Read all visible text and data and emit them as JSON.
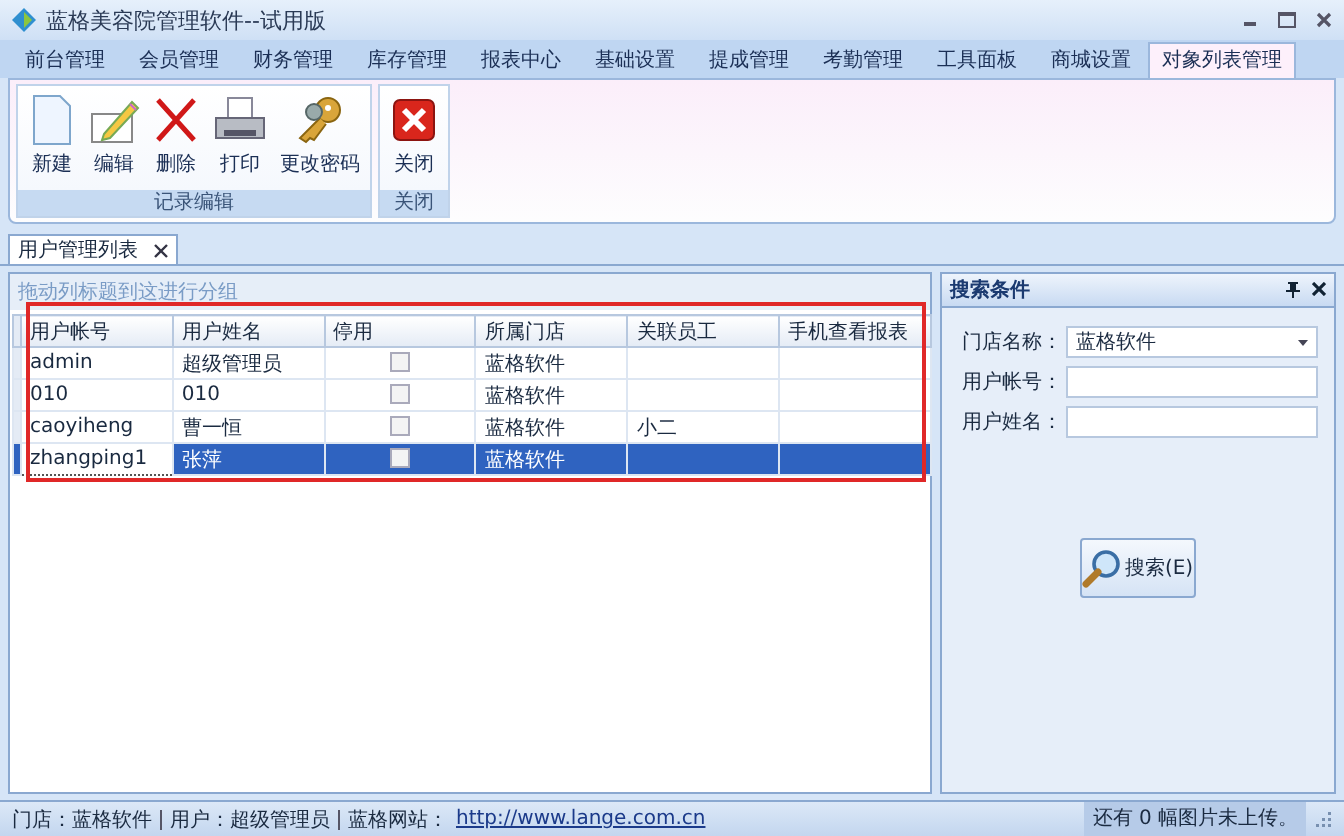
{
  "window": {
    "title": "蓝格美容院管理软件--试用版"
  },
  "menu_tabs": [
    {
      "label": "前台管理",
      "selected": false
    },
    {
      "label": "会员管理",
      "selected": false
    },
    {
      "label": "财务管理",
      "selected": false
    },
    {
      "label": "库存管理",
      "selected": false
    },
    {
      "label": "报表中心",
      "selected": false
    },
    {
      "label": "基础设置",
      "selected": false
    },
    {
      "label": "提成管理",
      "selected": false
    },
    {
      "label": "考勤管理",
      "selected": false
    },
    {
      "label": "工具面板",
      "selected": false
    },
    {
      "label": "商城设置",
      "selected": false
    },
    {
      "label": "对象列表管理",
      "selected": true
    }
  ],
  "ribbon": {
    "groups": [
      {
        "label": "记录编辑",
        "buttons": [
          {
            "label": "新建",
            "kind": "new"
          },
          {
            "label": "编辑",
            "kind": "edit"
          },
          {
            "label": "删除",
            "kind": "delete"
          },
          {
            "label": "打印",
            "kind": "print"
          },
          {
            "label": "更改密码",
            "kind": "password"
          }
        ]
      },
      {
        "label": "关闭",
        "buttons": [
          {
            "label": "关闭",
            "kind": "close"
          }
        ]
      }
    ]
  },
  "document_tabs": [
    {
      "label": "用户管理列表",
      "selected": true
    }
  ],
  "grid": {
    "group_hint": "拖动列标题到这进行分组",
    "columns": [
      "用户帐号",
      "用户姓名",
      "停用",
      "所属门店",
      "关联员工",
      "手机查看报表"
    ],
    "rows": [
      {
        "account": "admin",
        "name": "超级管理员",
        "disabled": false,
        "store": "蓝格软件",
        "selected": false
      },
      {
        "account": "010",
        "name": "010",
        "disabled": false,
        "store": "蓝格软件",
        "selected": false
      },
      {
        "account": "caoyiheng",
        "name": "曹一恒",
        "disabled": false,
        "store": "蓝格软件",
        "employee": "小二",
        "selected": false
      },
      {
        "account": "zhangping1",
        "name": "张萍",
        "disabled": false,
        "store": "蓝格软件",
        "selected": true
      }
    ]
  },
  "search_panel": {
    "title": "搜索条件",
    "fields": [
      {
        "label": "门店名称：",
        "value": "蓝格软件",
        "kind": "dropdown"
      },
      {
        "label": "用户帐号：",
        "kind": "text"
      },
      {
        "label": "用户姓名：",
        "kind": "text"
      }
    ],
    "button": "搜索(E)"
  },
  "status_bar": {
    "store": "门店：蓝格软件",
    "user": "用户：超级管理员",
    "site_label": "蓝格网站：",
    "link": "http://www.lange.com.cn",
    "upload_note": "还有 0 幅图片未上传。"
  }
}
